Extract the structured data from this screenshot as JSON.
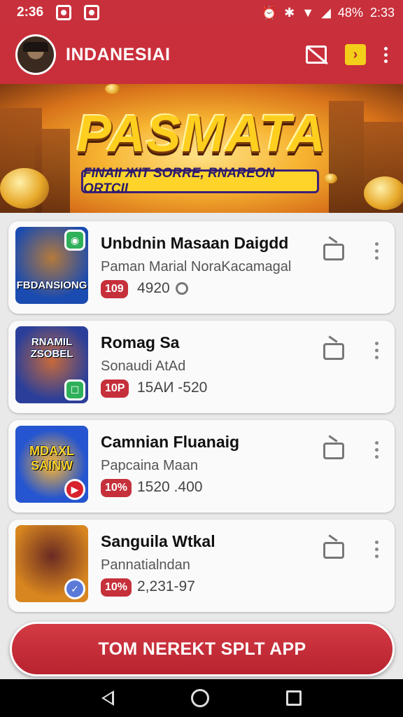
{
  "status_bar": {
    "time": "2:36",
    "battery": "48%",
    "clock_right": "2:33"
  },
  "app_bar": {
    "title": "INDANESIAI"
  },
  "banner": {
    "title": "PASMATA",
    "subtitle": "FINAII ЖIT SORRE, RNAREON ORTCII"
  },
  "apps": [
    {
      "title": "Unbdnin Masaan Daigdd",
      "subtitle": "Paman Marial NoraKacamagal",
      "badge": "109",
      "count": "4920",
      "thumb_text": "FBDANSIONG",
      "thumb_color": "#1a4bb0"
    },
    {
      "title": "Romag Sa",
      "subtitle": "Sonaudi AtAd",
      "badge": "10P",
      "count": "15AИ -520",
      "thumb_text": "RNAMIL ZSOBEL",
      "thumb_color": "#2b3f9a"
    },
    {
      "title": "Camnian Fluanaig",
      "subtitle": "Papcaina Maan",
      "badge": "10%",
      "count": "1520 .400",
      "thumb_text": "MDAXL SAINW",
      "thumb_color": "#2555d0"
    },
    {
      "title": "Sanguila Wtkal",
      "subtitle": "Pannatialndan",
      "badge": "10%",
      "count": "2,231-97",
      "thumb_text": "",
      "thumb_color": "#d8861f"
    }
  ],
  "cta": {
    "label": "TOM NEREKT SPLT APP"
  },
  "icons": {
    "status": [
      "app-notification-icon",
      "record-icon",
      "alarm-icon",
      "bluetooth-icon",
      "wifi-icon",
      "signal-icon"
    ],
    "app_bar": [
      "avatar",
      "cast-off-icon",
      "play-store-icon",
      "more-vertical-icon"
    ],
    "card": [
      "tv-icon",
      "more-vertical-icon"
    ],
    "nav": [
      "back-icon",
      "home-icon",
      "recents-icon"
    ]
  },
  "colors": {
    "brand_red": "#c92f3b",
    "banner_gold": "#ffcf1f",
    "pill_red": "#c5303b"
  }
}
